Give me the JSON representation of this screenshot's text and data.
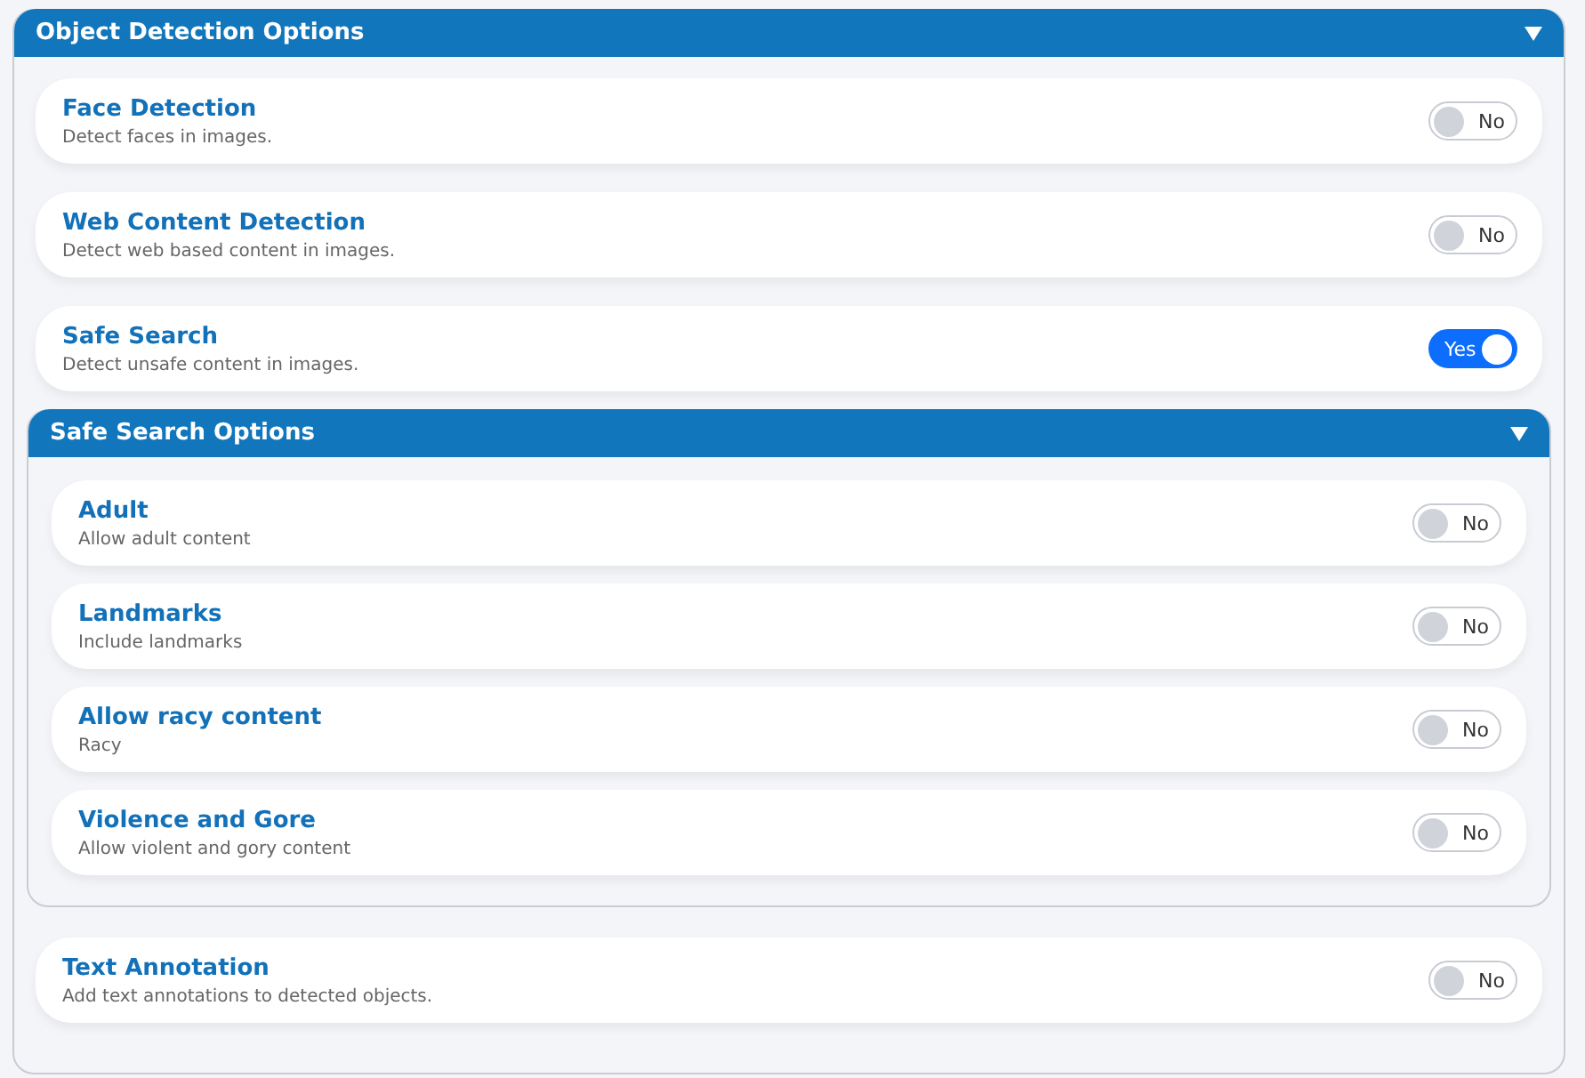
{
  "panel": {
    "title": "Object Detection Options",
    "expanded": true,
    "items": [
      {
        "kind": "toggle",
        "title": "Face Detection",
        "description": "Detect faces in images.",
        "on": false,
        "toggle_label": "No"
      },
      {
        "kind": "toggle",
        "title": "Web Content Detection",
        "description": "Detect web based content in images.",
        "on": false,
        "toggle_label": "No"
      },
      {
        "kind": "toggle",
        "title": "Safe Search",
        "description": "Detect unsafe content in images.",
        "on": true,
        "toggle_label": "Yes"
      },
      {
        "kind": "group",
        "title": "Safe Search Options",
        "expanded": true,
        "items": [
          {
            "kind": "toggle",
            "title": "Adult",
            "description": "Allow adult content",
            "on": false,
            "toggle_label": "No"
          },
          {
            "kind": "toggle",
            "title": "Landmarks",
            "description": "Include landmarks",
            "on": false,
            "toggle_label": "No"
          },
          {
            "kind": "toggle",
            "title": "Allow racy content",
            "description": "Racy",
            "on": false,
            "toggle_label": "No"
          },
          {
            "kind": "toggle",
            "title": "Violence and Gore",
            "description": "Allow violent and gory content",
            "on": false,
            "toggle_label": "No"
          }
        ]
      },
      {
        "kind": "toggle",
        "title": "Text Annotation",
        "description": "Add text annotations to detected objects.",
        "on": false,
        "toggle_label": "No"
      }
    ]
  }
}
